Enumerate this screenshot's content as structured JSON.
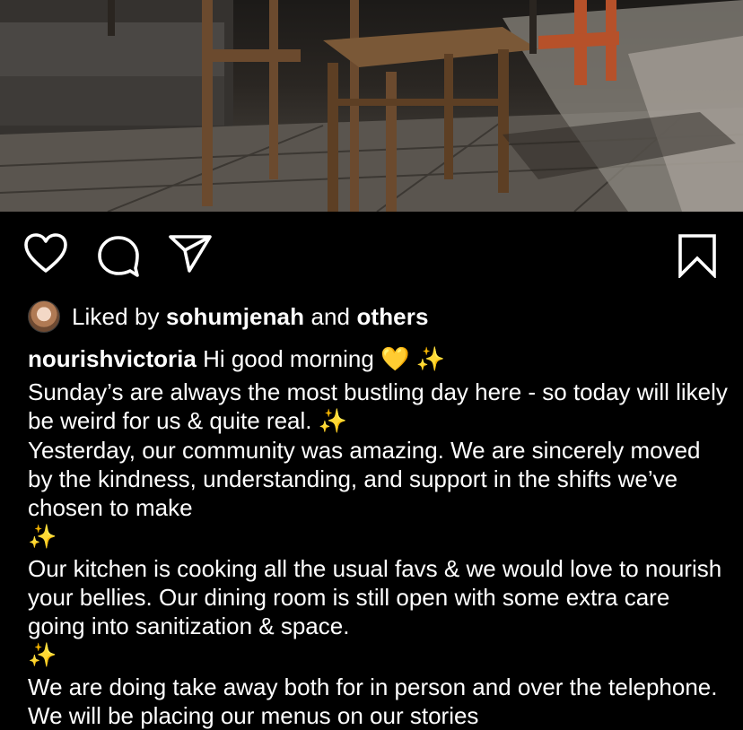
{
  "post": {
    "image_alt": "Photo of wooden dining chairs in a restaurant with sunlit floor",
    "actions": {
      "like_icon": "heart-outline",
      "comment_icon": "comment-bubble",
      "share_icon": "paper-plane",
      "save_icon": "bookmark-outline"
    },
    "likes": {
      "prefix": "Liked by",
      "user": "sohumjenah",
      "connector": "and",
      "others": "others"
    },
    "caption": {
      "username": "nourishvictoria",
      "greeting": "Hi good morning",
      "heart_emoji": "💛",
      "sparkle_emoji": "✨",
      "paragraph1": "Sunday’s are always the most bustling day here - so today will likely be weird for us & quite real.",
      "paragraph2": "Yesterday, our community was amazing.  We are sincerely moved by the kindness, understanding, and support in the shifts we’ve chosen to make",
      "paragraph3": "Our kitchen is cooking all the usual favs & we would love to nourish your bellies.  Our dining room is still open with some extra care going into sanitization & space.",
      "paragraph4": "We are doing take away both for in person and over the telephone.  We will be placing our menus on our stories"
    }
  },
  "colors": {
    "background": "#000000",
    "text": "#ffffff",
    "sparkle": "#f6d24a",
    "heart": "#f4c530"
  }
}
